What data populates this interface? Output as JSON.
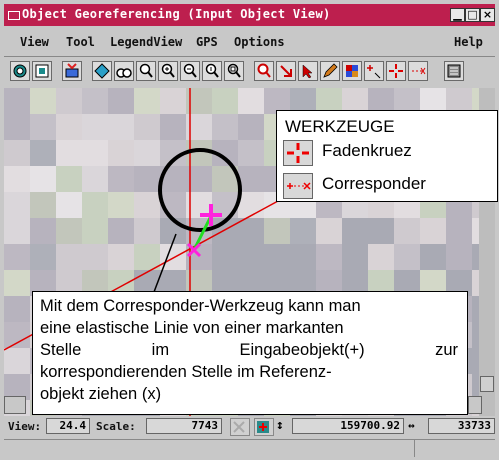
{
  "window": {
    "title": "Object Georeferencing (Input Object View)",
    "accent_color": "#bd1f4e",
    "controls": [
      "minimize-icon",
      "maximize-icon",
      "close-icon"
    ]
  },
  "menu": {
    "items": [
      "View",
      "Tool",
      "LegendView",
      "GPS",
      "Options"
    ],
    "help": "Help"
  },
  "toolbar": {
    "tools": [
      "target-icon",
      "frame-icon",
      "add-layer-icon",
      "diamond-icon",
      "binoculars-icon",
      "zoom-box-icon",
      "zoom-in-icon",
      "zoom-out-icon",
      "zoom-1x-icon",
      "zoom-fit-icon",
      "search-red-icon",
      "select-arrow-icon",
      "pointer-icon",
      "edit-icon",
      "legend-icon",
      "point-add-icon",
      "crosshair-icon",
      "corresponder-icon",
      "settings-icon"
    ]
  },
  "callout_tools": {
    "heading": "WERKZEUGE",
    "items": [
      {
        "icon": "crosshair-tool-icon",
        "label": "Fadenkruez"
      },
      {
        "icon": "corresponder-tool-icon",
        "label": "Corresponder"
      }
    ]
  },
  "callout_info": {
    "lines": [
      "Mit dem Corresponder-Werkzeug kann man",
      "eine elastische Linie von einer markanten",
      "Stelle im Eingabeobjekt(+) zur",
      "korrespondierenden Stelle im Referenz-",
      "objekt ziehen (x)"
    ]
  },
  "status": {
    "view_label": "View:",
    "view_value": "24.4",
    "scale_label": "Scale:",
    "scale_value": "7743",
    "coord_x": "159700.92",
    "coord_y": "33733"
  }
}
